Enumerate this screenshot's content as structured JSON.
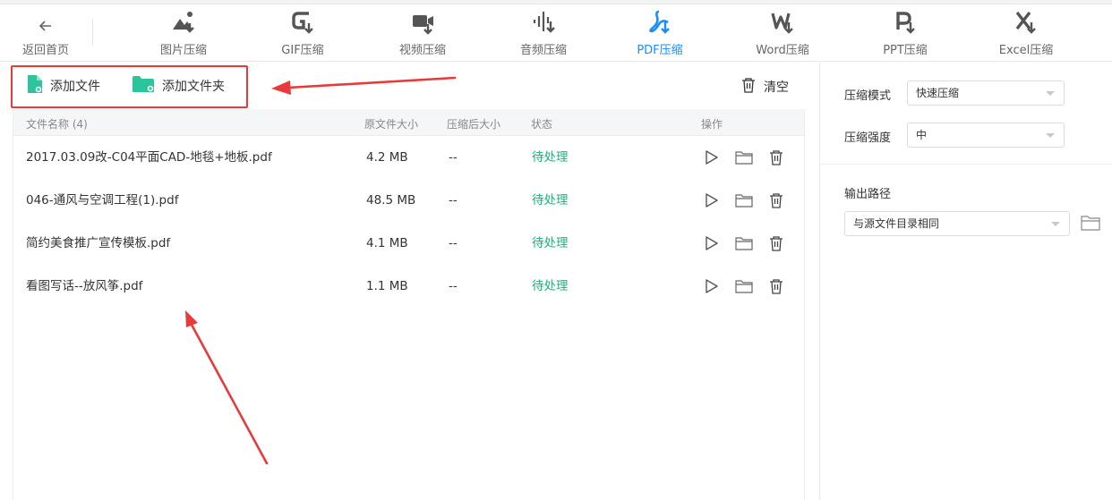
{
  "toolbar": {
    "back": {
      "label": "返回首页",
      "icon": "back-arrow-icon"
    },
    "tools": [
      {
        "key": "image",
        "label": "图片压缩",
        "icon": "image-compress-icon"
      },
      {
        "key": "gif",
        "label": "GIF压缩",
        "icon": "gif-compress-icon"
      },
      {
        "key": "video",
        "label": "视频压缩",
        "icon": "video-compress-icon"
      },
      {
        "key": "audio",
        "label": "音频压缩",
        "icon": "audio-compress-icon"
      },
      {
        "key": "pdf",
        "label": "PDF压缩",
        "icon": "pdf-compress-icon",
        "active": true
      },
      {
        "key": "word",
        "label": "Word压缩",
        "icon": "word-compress-icon"
      },
      {
        "key": "ppt",
        "label": "PPT压缩",
        "icon": "ppt-compress-icon"
      },
      {
        "key": "excel",
        "label": "Excel压缩",
        "icon": "excel-compress-icon"
      }
    ],
    "accent_color": "#1a8cff"
  },
  "actions": {
    "add_file": "添加文件",
    "add_folder": "添加文件夹",
    "clear": "清空"
  },
  "table": {
    "columns": {
      "name": "文件名称 (4)",
      "orig_size": "原文件大小",
      "comp_size": "压缩后大小",
      "status": "状态",
      "ops": "操作"
    },
    "rows": [
      {
        "name": "2017.03.09改-C04平面CAD-地毯+地板.pdf",
        "orig_size": "4.2 MB",
        "comp_size": "--",
        "status": "待处理"
      },
      {
        "name": "046-通风与空调工程(1).pdf",
        "orig_size": "48.5 MB",
        "comp_size": "--",
        "status": "待处理"
      },
      {
        "name": "简约美食推广宣传模板.pdf",
        "orig_size": "4.1 MB",
        "comp_size": "--",
        "status": "待处理"
      },
      {
        "name": "看图写话--放风筝.pdf",
        "orig_size": "1.1 MB",
        "comp_size": "--",
        "status": "待处理"
      }
    ],
    "status_color": "#19b37a"
  },
  "settings": {
    "mode_label": "压缩模式",
    "mode_value": "快速压缩",
    "strength_label": "压缩强度",
    "strength_value": "中",
    "output_label": "输出路径",
    "output_value": "与源文件目录相同"
  },
  "annotation_color": "#e83a3a"
}
